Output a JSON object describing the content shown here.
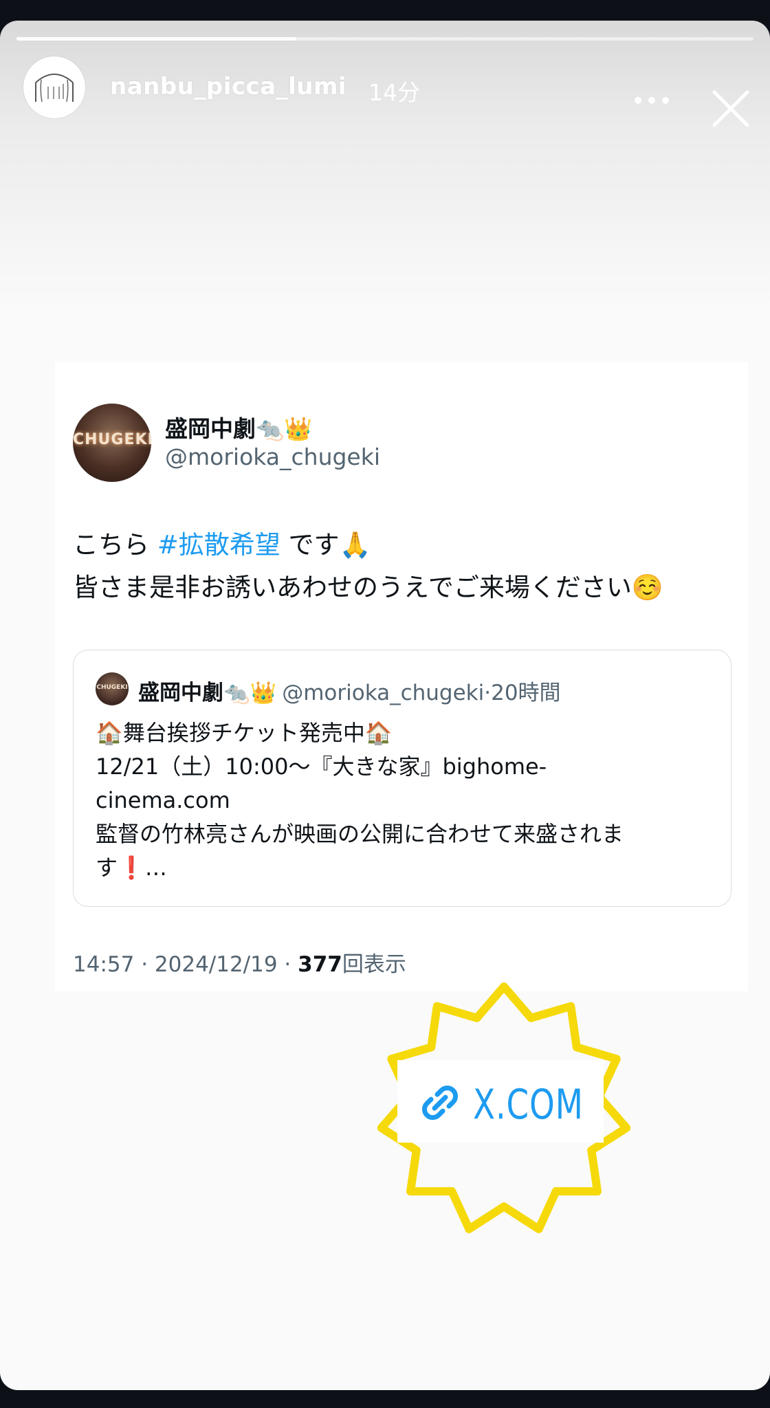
{
  "story": {
    "username": "nanbu_picca_lumi",
    "time_ago": "14分",
    "progress": 0.38,
    "icons": {
      "more": "more-dots-icon",
      "close": "close-icon"
    }
  },
  "tweet": {
    "author_name": "盛岡中劇🐀👑",
    "author_handle": "@morioka_chugeki",
    "avatar_text": "CHUGEKI",
    "body_line1_pre": "こちら ",
    "hashtag": "#拡散希望",
    "body_line1_post": " です🙏",
    "body_line2": "皆さま是非お誘いあわせのうえでご来場ください☺️",
    "meta_time": "14:57 · 2024/12/19 · ",
    "meta_views": "377",
    "meta_views_label": "回表示",
    "hashtag_color": "#1d9bf0"
  },
  "quote": {
    "name": "盛岡中劇🐀👑",
    "handle": "@morioka_chugeki",
    "dot": "·",
    "time": "20時間",
    "avatar_text": "CHUGEKI",
    "line1": "🏠舞台挨拶チケット発売中🏠",
    "line2": "12/21（土）10:00〜『大きな家』bighome-",
    "line3": "cinema.com",
    "line4": "監督の竹林亮さんが映画の公開に合わせて来盛されま",
    "line5": "す❗️…"
  },
  "link_sticker": {
    "label": "X.COM",
    "icon": "link-icon",
    "burst_color": "#f5d90a",
    "text_color": "#1d9bf0"
  }
}
